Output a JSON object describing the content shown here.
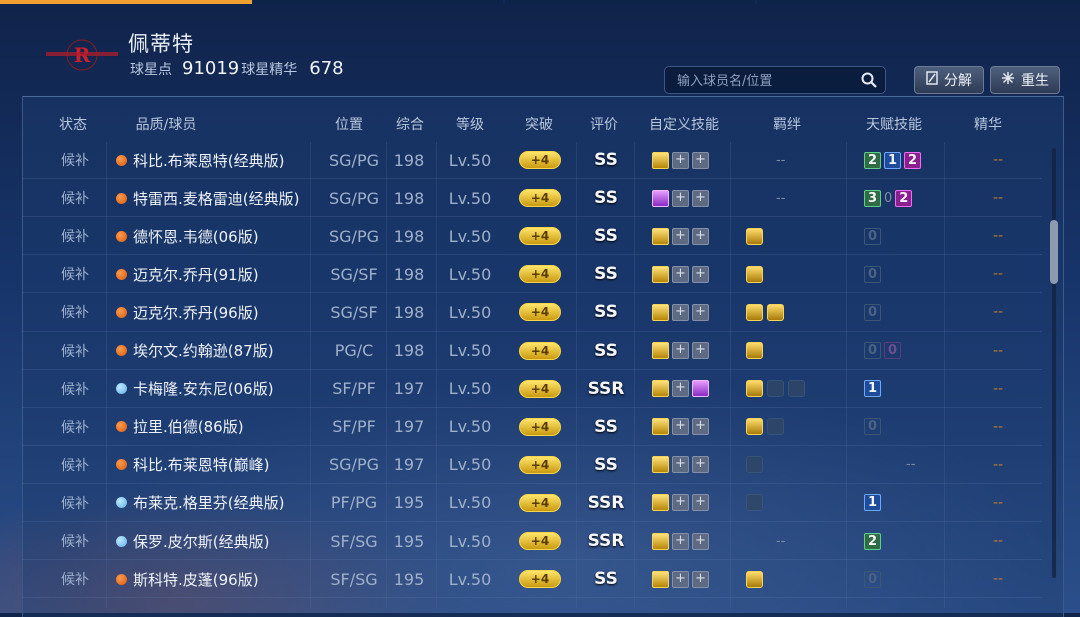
{
  "header": {
    "player_name": "佩蒂特",
    "points_label": "球星点",
    "points_value": "91019",
    "essence_label": "球星精华",
    "essence_value": "678",
    "logo": "rockets-logo",
    "search_placeholder": "输入球员名/位置",
    "decompose_label": "分解",
    "rebirth_label": "重生"
  },
  "columns": [
    "状态",
    "品质/球员",
    "位置",
    "综合",
    "等级",
    "突破",
    "评价",
    "自定义技能",
    "羁绊",
    "天赋技能",
    "精华"
  ],
  "rows": [
    {
      "status": "候补",
      "dot": "orange",
      "name": "科比.布莱恩特(经典版)",
      "pos": "SG/PG",
      "ovr": "198",
      "lvl": "Lv.50",
      "brk": "+4",
      "rate": "SS",
      "skills": [
        "gold",
        "plus",
        "plus"
      ],
      "bonds": "--",
      "talents": [
        {
          "t": "green",
          "v": "2"
        },
        {
          "t": "blue",
          "v": "1"
        },
        {
          "t": "mag",
          "v": "2"
        }
      ],
      "ess": "--"
    },
    {
      "status": "候补",
      "dot": "orange",
      "name": "特雷西.麦格雷迪(经典版)",
      "pos": "SG/PG",
      "ovr": "198",
      "lvl": "Lv.50",
      "brk": "+4",
      "rate": "SS",
      "skills": [
        "purple",
        "plus",
        "plus"
      ],
      "bonds": "--",
      "talents": [
        {
          "t": "green",
          "v": "3"
        },
        {
          "t": "plain",
          "v": "0"
        },
        {
          "t": "mag",
          "v": "2"
        }
      ],
      "ess": "--"
    },
    {
      "status": "候补",
      "dot": "orange",
      "name": "德怀恩.韦德(06版)",
      "pos": "SG/PG",
      "ovr": "198",
      "lvl": "Lv.50",
      "brk": "+4",
      "rate": "SS",
      "skills": [
        "gold",
        "plus",
        "plus"
      ],
      "bonds": [
        "gold"
      ],
      "talents": [
        {
          "t": "off",
          "v": "0"
        }
      ],
      "ess": "--"
    },
    {
      "status": "候补",
      "dot": "orange",
      "name": "迈克尔.乔丹(91版)",
      "pos": "SG/SF",
      "ovr": "198",
      "lvl": "Lv.50",
      "brk": "+4",
      "rate": "SS",
      "skills": [
        "gold",
        "plus",
        "plus"
      ],
      "bonds": [
        "gold"
      ],
      "talents": [
        {
          "t": "off",
          "v": "0"
        }
      ],
      "ess": "--"
    },
    {
      "status": "候补",
      "dot": "orange",
      "name": "迈克尔.乔丹(96版)",
      "pos": "SG/SF",
      "ovr": "198",
      "lvl": "Lv.50",
      "brk": "+4",
      "rate": "SS",
      "skills": [
        "gold",
        "plus",
        "plus"
      ],
      "bonds": [
        "gold",
        "gold"
      ],
      "talents": [
        {
          "t": "off",
          "v": "0"
        }
      ],
      "ess": "--"
    },
    {
      "status": "候补",
      "dot": "orange",
      "name": "埃尔文.约翰逊(87版)",
      "pos": "PG/C",
      "ovr": "198",
      "lvl": "Lv.50",
      "brk": "+4",
      "rate": "SS",
      "skills": [
        "gold",
        "plus",
        "plus"
      ],
      "bonds": [
        "gold"
      ],
      "talents": [
        {
          "t": "off",
          "v": "0"
        },
        {
          "t": "offm",
          "v": "0"
        }
      ],
      "ess": "--"
    },
    {
      "status": "候补",
      "dot": "blue",
      "name": "卡梅隆.安东尼(06版)",
      "pos": "SF/PF",
      "ovr": "197",
      "lvl": "Lv.50",
      "brk": "+4",
      "rate": "SSR",
      "skills": [
        "gold",
        "plus",
        "purple"
      ],
      "bonds": [
        "gold",
        "dim",
        "dim"
      ],
      "talents": [
        {
          "t": "blue",
          "v": "1"
        }
      ],
      "ess": "--"
    },
    {
      "status": "候补",
      "dot": "orange",
      "name": "拉里.伯德(86版)",
      "pos": "SF/PF",
      "ovr": "197",
      "lvl": "Lv.50",
      "brk": "+4",
      "rate": "SS",
      "skills": [
        "gold",
        "plus",
        "plus"
      ],
      "bonds": [
        "gold",
        "dim"
      ],
      "talents": [
        {
          "t": "off",
          "v": "0"
        }
      ],
      "ess": "--"
    },
    {
      "status": "候补",
      "dot": "orange",
      "name": "科比.布莱恩特(巅峰)",
      "pos": "SG/PG",
      "ovr": "197",
      "lvl": "Lv.50",
      "brk": "+4",
      "rate": "SS",
      "skills": [
        "gold",
        "plus",
        "plus"
      ],
      "bonds": [
        "dim"
      ],
      "talents": [
        {
          "t": "plain",
          "v": "--"
        }
      ],
      "ess": "--"
    },
    {
      "status": "候补",
      "dot": "blue",
      "name": "布莱克.格里芬(经典版)",
      "pos": "PF/PG",
      "ovr": "195",
      "lvl": "Lv.50",
      "brk": "+4",
      "rate": "SSR",
      "skills": [
        "gold",
        "plus",
        "plus"
      ],
      "bonds": [
        "dim"
      ],
      "talents": [
        {
          "t": "blue",
          "v": "1"
        }
      ],
      "ess": "--"
    },
    {
      "status": "候补",
      "dot": "blue",
      "name": "保罗.皮尔斯(经典版)",
      "pos": "SF/SG",
      "ovr": "195",
      "lvl": "Lv.50",
      "brk": "+4",
      "rate": "SSR",
      "skills": [
        "gold",
        "plus",
        "plus"
      ],
      "bonds": "--",
      "talents": [
        {
          "t": "green",
          "v": "2"
        }
      ],
      "ess": "--"
    },
    {
      "status": "候补",
      "dot": "orange",
      "name": "斯科特.皮蓬(96版)",
      "pos": "SF/SG",
      "ovr": "195",
      "lvl": "Lv.50",
      "brk": "+4",
      "rate": "SS",
      "skills": [
        "gold",
        "plus",
        "plus"
      ],
      "bonds": [
        "gold"
      ],
      "talents": [
        {
          "t": "off",
          "v": "0"
        }
      ],
      "ess": "--"
    }
  ],
  "colors": {
    "accent_orange": "#f0a030",
    "gold": "#f5d35a",
    "background": "#17346a"
  },
  "icons": {
    "search": "search-icon",
    "decompose": "decompose-icon",
    "rebirth": "rebirth-icon"
  }
}
